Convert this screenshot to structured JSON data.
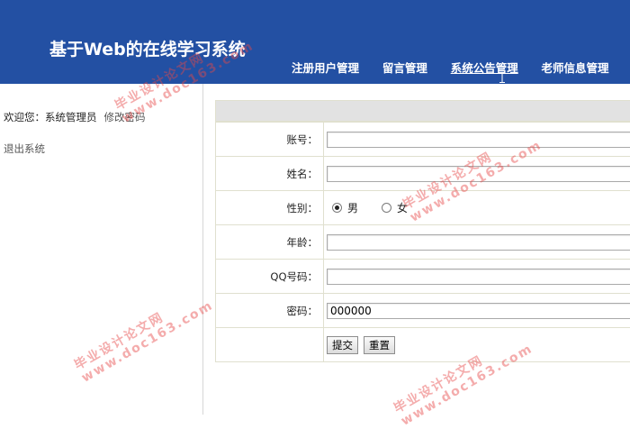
{
  "header": {
    "title": "基于Web的在线学习系统",
    "nav": [
      {
        "label": "注册用户管理",
        "active": false
      },
      {
        "label": "留言管理",
        "active": false
      },
      {
        "label": "系统公告管理",
        "active": true
      },
      {
        "label": "老师信息管理",
        "active": false
      }
    ]
  },
  "sidebar": {
    "welcome": "欢迎您：系统管理员",
    "change_password": "修改密码",
    "logout": "退出系统"
  },
  "form": {
    "fields": [
      {
        "label": "账号：",
        "value": ""
      },
      {
        "label": "姓名：",
        "value": ""
      },
      {
        "label": "年龄：",
        "value": ""
      },
      {
        "label": "QQ号码：",
        "value": ""
      },
      {
        "label": "密码：",
        "value": "000000"
      }
    ],
    "gender": {
      "label": "性别：",
      "options": [
        "男",
        "女"
      ],
      "selected": "男"
    },
    "submit_label": "提交",
    "reset_label": "重置"
  },
  "watermark": {
    "line1": "毕业设计论文网",
    "line2": "www.doc163.com"
  },
  "colors": {
    "header_bg": "#2350a3",
    "form_border": "#e0e0cf",
    "form_header_bg": "#e2e2e2",
    "watermark": "#e64646"
  }
}
